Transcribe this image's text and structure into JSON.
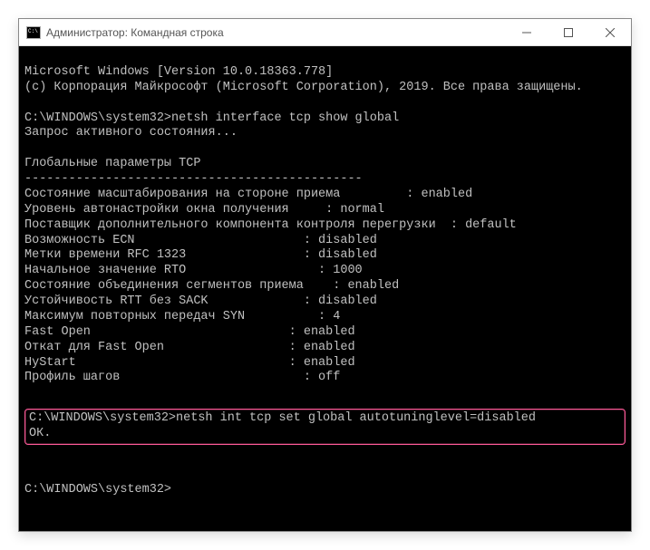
{
  "titlebar": {
    "text": "Администратор: Командная строка"
  },
  "console": {
    "header1": "Microsoft Windows [Version 10.0.18363.778]",
    "header2": "(c) Корпорация Майкрософт (Microsoft Corporation), 2019. Все права защищены.",
    "blank": "",
    "prompt1": "C:\\WINDOWS\\system32>netsh interface tcp show global",
    "querying": "Запрос активного состояния...",
    "section_title": "Глобальные параметры TCP",
    "divider": "----------------------------------------------",
    "row1": "Состояние масштабирования на стороне приема         : enabled",
    "row2": "Уровень автонастройки окна получения     : normal",
    "row3": "Поставщик дополнительного компонента контроля перегрузки  : default",
    "row4": "Возможность ECN                       : disabled",
    "row5": "Метки времени RFC 1323                : disabled",
    "row6": "Начальное значение RTO                  : 1000",
    "row7": "Состояние объединения сегментов приема    : enabled",
    "row8": "Устойчивость RTT без SACK             : disabled",
    "row9": "Максимум повторных передач SYN          : 4",
    "row10": "Fast Open                           : enabled",
    "row11": "Откат для Fast Open                 : enabled",
    "row12": "HyStart                             : enabled",
    "row13": "Профиль шагов                         : off",
    "highlight_line1": "C:\\WINDOWS\\system32>netsh int tcp set global autotuninglevel=disabled",
    "highlight_line2": "ОК.",
    "prompt2": "C:\\WINDOWS\\system32>"
  }
}
